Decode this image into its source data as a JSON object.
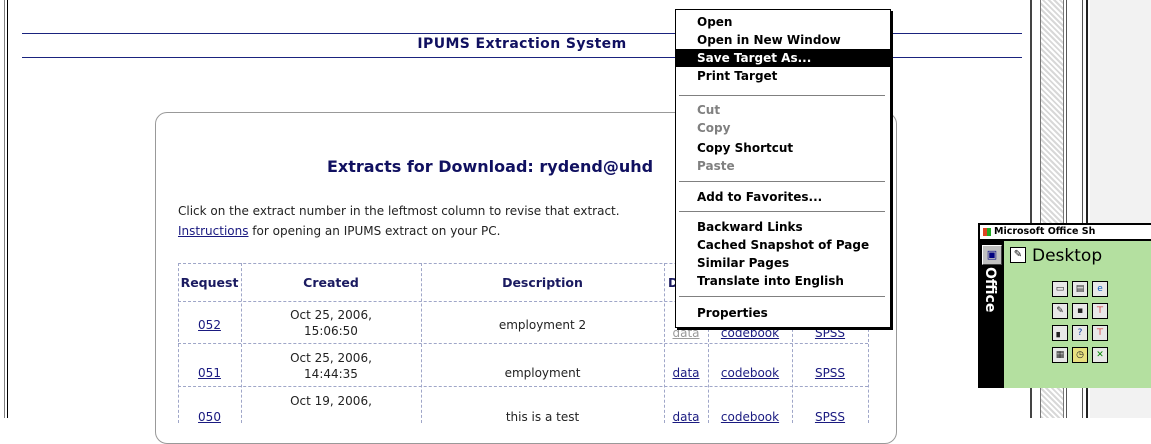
{
  "header": {
    "title": "IPUMS Extraction System"
  },
  "page": {
    "title": "Extracts for Download: rydend@uhd",
    "instructions_line1": "Click on the extract number in the leftmost column to revise that extract.",
    "instructions_link": "Instructions",
    "instructions_rest": " for opening an IPUMS extract on your PC."
  },
  "table": {
    "headers": [
      "Request",
      "Created",
      "Description",
      "Da"
    ],
    "rows": [
      {
        "request": "052",
        "created_date": "Oct 25, 2006,",
        "created_time": "15:06:50",
        "description": "employment 2",
        "data": "data",
        "codebook": "codebook",
        "spss": "SPSS"
      },
      {
        "request": "051",
        "created_date": "Oct 25, 2006,",
        "created_time": "14:44:35",
        "description": "employment",
        "data": "data",
        "codebook": "codebook",
        "spss": "SPSS"
      },
      {
        "request": "050",
        "created_date": "Oct 19, 2006,",
        "created_time": "",
        "description": "this is a test",
        "data": "data",
        "codebook": "codebook",
        "spss": "SPSS"
      }
    ]
  },
  "context_menu": {
    "groups": [
      [
        {
          "label": "Open",
          "state": "normal"
        },
        {
          "label": "Open in New Window",
          "state": "normal"
        },
        {
          "label": "Save Target As...",
          "state": "selected"
        },
        {
          "label": "Print Target",
          "state": "normal"
        }
      ],
      [
        {
          "label": "Cut",
          "state": "disabled"
        },
        {
          "label": "Copy",
          "state": "disabled"
        },
        {
          "label": "Copy Shortcut",
          "state": "normal"
        },
        {
          "label": "Paste",
          "state": "disabled"
        }
      ],
      [
        {
          "label": "Add to Favorites...",
          "state": "normal"
        }
      ],
      [
        {
          "label": "Backward Links",
          "state": "normal"
        },
        {
          "label": "Cached Snapshot of Page",
          "state": "normal"
        },
        {
          "label": "Similar Pages",
          "state": "normal"
        },
        {
          "label": "Translate into English",
          "state": "normal"
        }
      ],
      [
        {
          "label": "Properties",
          "state": "normal"
        }
      ]
    ]
  },
  "office_bar": {
    "title": "Microsoft Office Sh",
    "vertical_label": "Office",
    "desktop_label": "Desktop",
    "icons": [
      "computer-icon",
      "folder-icon",
      "ie-icon",
      "edit-icon",
      "doc-icon",
      "pdf-icon",
      "clip-icon",
      "help-icon",
      "acrobat-icon",
      "grid-icon",
      "clock-icon",
      "excel-icon"
    ]
  },
  "colors": {
    "accent": "#1a1a80",
    "header_line": "#1a237e",
    "office_panel": "#b4e0a0"
  }
}
